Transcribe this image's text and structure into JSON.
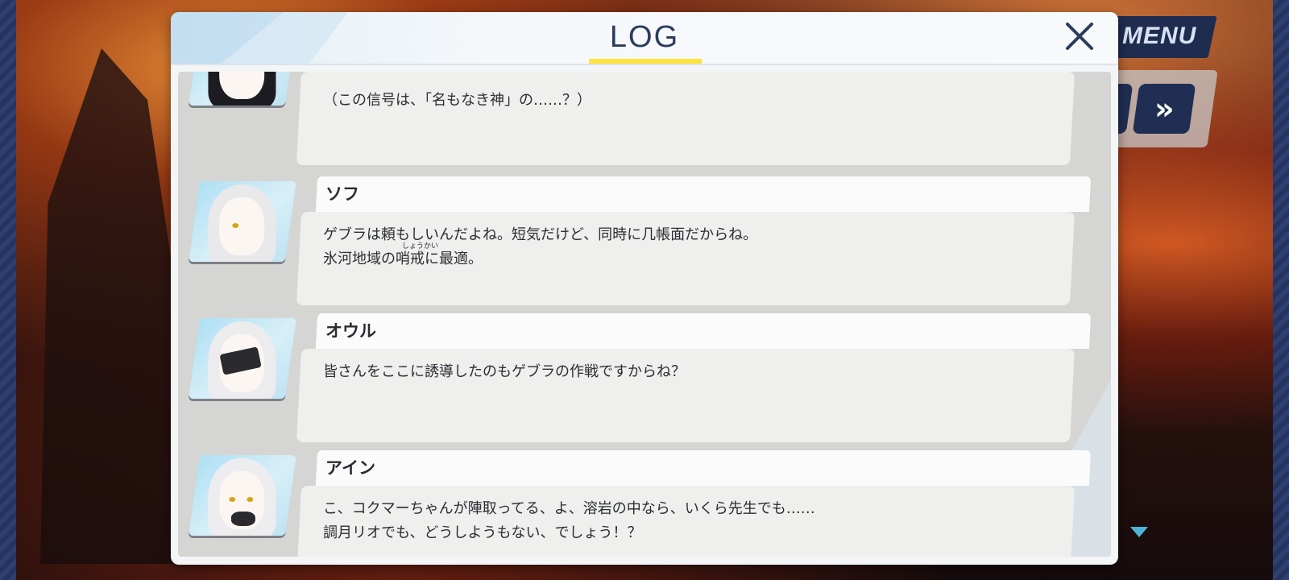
{
  "window": {
    "title": "LOG"
  },
  "hud": {
    "menu_label": "MENU",
    "fast_forward_glyph": "»"
  },
  "log_entries": [
    {
      "speaker": "",
      "lines": [
        "（この信号は、「名もなき神」の……？）"
      ],
      "portrait": "black-hair-red-eyes"
    },
    {
      "speaker": "ソフ",
      "lines": [
        "ゲブラは頼もしいんだよね。短気だけど、同時に几帳面だからね。",
        "氷河地域の哨戒に最適。"
      ],
      "ruby": "しょうかい",
      "portrait": "white-hair-headset"
    },
    {
      "speaker": "オウル",
      "lines": [
        "皆さんをここに誘導したのもゲブラの作戦ですからね？"
      ],
      "portrait": "white-hair-visor"
    },
    {
      "speaker": "アイン",
      "lines": [
        "こ、コクマーちゃんが陣取ってる、よ、溶岩の中なら、いくら先生でも……",
        "調月リオでも、どうしようもない、でしょう！？"
      ],
      "portrait": "white-hair-mask"
    }
  ],
  "colors": {
    "accent_underline": "#ffe23a",
    "title_text": "#2b3d5b",
    "hud_dark": "#1f2e52"
  }
}
